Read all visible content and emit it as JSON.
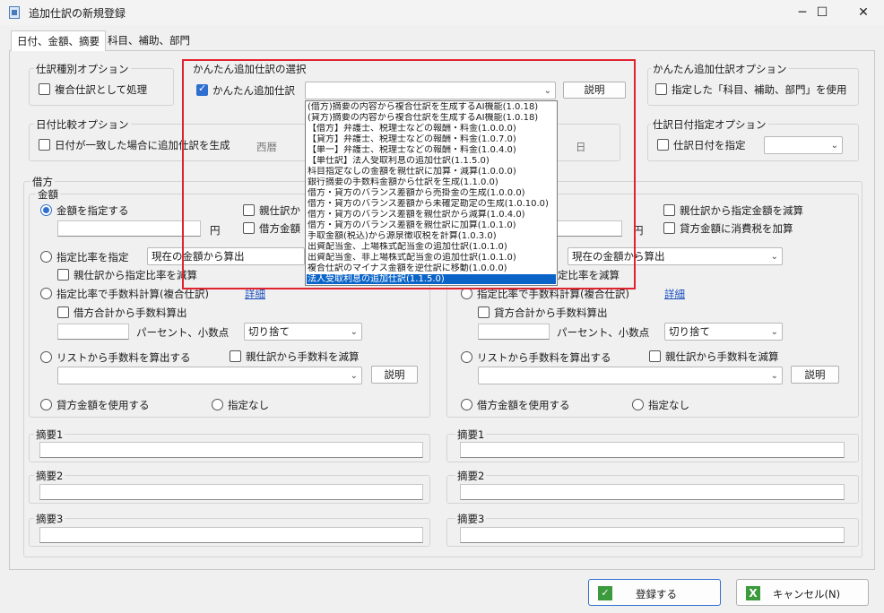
{
  "window": {
    "title": "追加仕訳の新規登録",
    "minimize": "─",
    "maximize": "☐",
    "close": "✕"
  },
  "tabs": [
    "日付、金額、摘要",
    "科目、補助、部門"
  ],
  "journal_type": {
    "group": "仕訳種別オプション",
    "compound": "複合仕訳として処理"
  },
  "easy": {
    "group": "かんたん追加仕訳の選択",
    "checkbox": "かんたん追加仕訳",
    "explain": "説明",
    "options": [
      "(借方)摘要の内容から複合仕訳を生成するAI機能(1.0.18)",
      "(貸方)摘要の内容から複合仕訳を生成するAI機能(1.0.18)",
      "【借方】弁護士、税理士などの報酬・料金(1.0.0.0)",
      "【貸方】弁護士、税理士などの報酬・料金(1.0.7.0)",
      "【単一】弁護士、税理士などの報酬・料金(1.0.4.0)",
      "【単仕訳】法人受取利息の追加仕訳(1.1.5.0)",
      "科目指定なしの金額を親仕訳に加算・減算(1.0.0.0)",
      "銀行摘要の手数料金額から仕訳を生成(1.1.0.0)",
      "借方・貸方のバランス差額から売掛金の生成(1.0.0.0)",
      "借方・貸方のバランス差額から未確定勘定の生成(1.0.10.0)",
      "借方・貸方のバランス差額を親仕訳から減算(1.0.4.0)",
      "借方・貸方のバランス差額を親仕訳に加算(1.0.1.0)",
      "手取金額(税込)から源泉徴収税を計算(1.0.3.0)",
      "出資配当金、上場株式配当金の追加仕訳(1.0.1.0)",
      "出資配当金、非上場株式配当金の追加仕訳(1.0.1.0)",
      "複合仕訳のマイナス金額を逆仕訳に移動(1.0.0.0)",
      "法人受取利息の追加仕訳(1.1.5.0)"
    ]
  },
  "easy_option": {
    "group": "かんたん追加仕訳オプション",
    "checkbox": "指定した「科目、補助、部門」を使用"
  },
  "date_compare": {
    "group": "日付比較オプション",
    "checkbox": "日付が一致した場合に追加仕訳を生成",
    "era": "西暦",
    "day": "日"
  },
  "date_spec": {
    "group": "仕訳日付指定オプション",
    "checkbox": "仕訳日付を指定"
  },
  "debit": {
    "group": "借方",
    "amount": "金額",
    "specify": "金額を指定する",
    "yen": "円",
    "parent_fragment": "親仕訳か",
    "credit_fragment": "借方金額",
    "ratio": "指定比率を指定",
    "calc_from": "現在の金額から算出",
    "parent_ratio": "親仕訳から指定比率を減算",
    "fee": "指定比率で手数料計算(複合仕訳)",
    "detail": "詳細",
    "fee_total": "借方合計から手数料算出",
    "percent": "パーセント、小数点",
    "round": "切り捨て",
    "list_fee": "リストから手数料を算出する",
    "parent_fee": "親仕訳から手数料を減算",
    "explain": "説明",
    "use_other": "貸方金額を使用する",
    "none": "指定なし"
  },
  "credit": {
    "yen": "円",
    "parent_amount": "親仕訳から指定金額を減算",
    "tax": "貸方金額に消費税を加算",
    "calc_from": "現在の金額から算出",
    "ratio_fragment": "定比率を減算",
    "fee": "指定比率で手数料計算(複合仕訳)",
    "detail": "詳細",
    "fee_total": "貸方合計から手数料算出",
    "percent": "パーセント、小数点",
    "round": "切り捨て",
    "list_fee": "リストから手数料を算出する",
    "parent_fee": "親仕訳から手数料を減算",
    "explain": "説明",
    "use_other": "借方金額を使用する",
    "none": "指定なし"
  },
  "memos": [
    "摘要1",
    "摘要2",
    "摘要3"
  ],
  "footer": {
    "register": "登録する",
    "cancel": "キャンセル(N)"
  },
  "colors": {
    "accent": "#2f6fcf",
    "highlight": "#e0232f",
    "selection": "#0a64c8"
  }
}
